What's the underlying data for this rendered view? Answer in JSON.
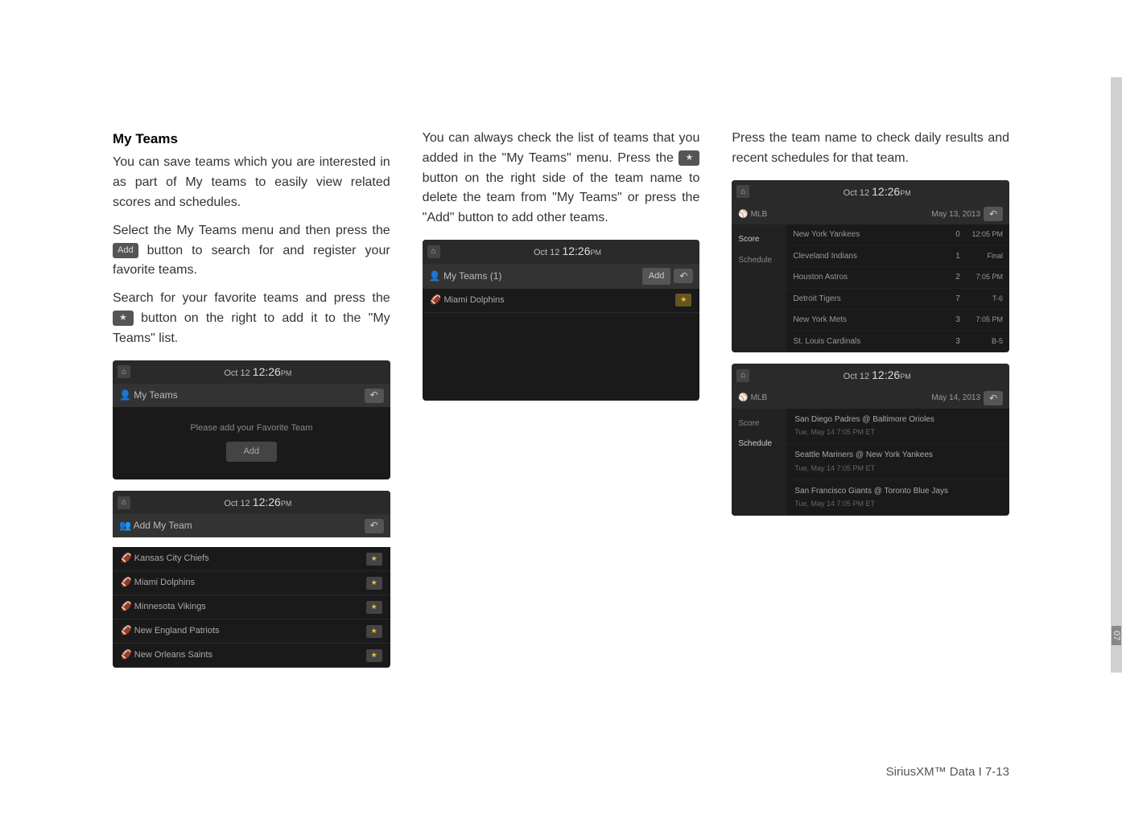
{
  "section_title": "My Teams",
  "col1": {
    "p1": "You can save teams which you are interested in as part of My teams to easily view related scores and schedules.",
    "p2a": "Select the My Teams menu and then press the ",
    "add_btn": "Add",
    "p2b": " button to search for and register your favorite teams.",
    "p3a": "Search for your favorite teams and press the ",
    "star_btn": "★",
    "p3b": " button on the right to add it to the \"My Teams\" list."
  },
  "col2": {
    "p1a": "You can always check the list of teams that you added in the \"My Teams\" menu. Press the ",
    "star_btn": "★",
    "p1b": " button on the right side of the team name to delete the team from \"My Teams\" or press the \"Add\" button to add other teams."
  },
  "col3": {
    "p1": "Press the team name to check daily results and recent schedules for that team."
  },
  "time_display": {
    "date": "Oct 12",
    "time": "12:26",
    "ampm": "PM"
  },
  "ss1": {
    "title": "My Teams",
    "msg": "Please add your Favorite Team",
    "btn": "Add"
  },
  "ss2": {
    "title": "Add My Team",
    "items": [
      "Kansas City Chiefs",
      "Miami Dolphins",
      "Minnesota Vikings",
      "New England Patriots",
      "New Orleans Saints"
    ]
  },
  "ss3": {
    "title": "My Teams (1)",
    "add": "Add",
    "items": [
      "Miami Dolphins"
    ]
  },
  "ss4": {
    "league": "MLB",
    "date_label": "May 13, 2013",
    "sidebar": [
      "Score",
      "Schedule"
    ],
    "rows": [
      {
        "team": "New York Yankees",
        "num": "0",
        "stat": "12:05 PM"
      },
      {
        "team": "Cleveland Indians",
        "num": "1",
        "stat": "Final"
      },
      {
        "team": "Houston Astros",
        "num": "2",
        "stat": "7:05 PM"
      },
      {
        "team": "Detroit Tigers",
        "num": "7",
        "stat": "T-6"
      },
      {
        "team": "New York Mets",
        "num": "3",
        "stat": "7:05 PM"
      },
      {
        "team": "St. Louis Cardinals",
        "num": "3",
        "stat": "B-5"
      }
    ]
  },
  "ss5": {
    "league": "MLB",
    "date_label": "May 14, 2013",
    "sidebar": [
      "Score",
      "Schedule"
    ],
    "rows": [
      {
        "title": "San Diego Padres @ Baltimore Orioles",
        "time": "Tue, May 14  7:05 PM ET"
      },
      {
        "title": "Seattle Mariners @ New York Yankees",
        "time": "Tue, May 14  7:05 PM ET"
      },
      {
        "title": "San Francisco Giants @ Toronto Blue Jays",
        "time": "Tue, May 14  7:05 PM ET"
      }
    ]
  },
  "footer": "SiriusXM™ Data I 7-13",
  "side_num": "07"
}
